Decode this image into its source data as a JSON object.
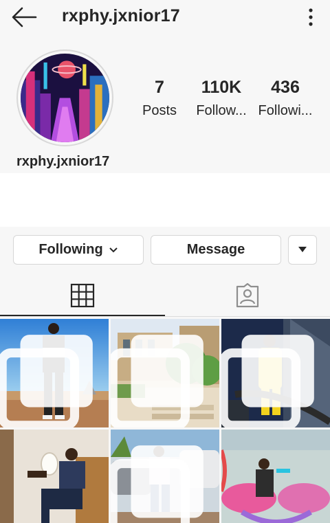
{
  "header": {
    "username": "rxphy.jxnior17"
  },
  "stats": [
    {
      "value": "7",
      "label": "Posts"
    },
    {
      "value": "110K",
      "label": "Follow..."
    },
    {
      "value": "436",
      "label": "Followi..."
    }
  ],
  "profile": {
    "name": "rxphy.jxnior17"
  },
  "actions": {
    "following_label": "Following",
    "message_label": "Message"
  },
  "tabs": [
    {
      "icon": "grid-icon"
    },
    {
      "icon": "tagged-icon"
    }
  ],
  "posts": [
    {
      "icon": "multiple-photos-icon"
    },
    {
      "icon": "multiple-photos-icon"
    },
    {
      "icon": "multiple-photos-icon"
    },
    {
      "icon": ""
    },
    {
      "icon": "multiple-photos-icon"
    },
    {
      "icon": ""
    }
  ]
}
